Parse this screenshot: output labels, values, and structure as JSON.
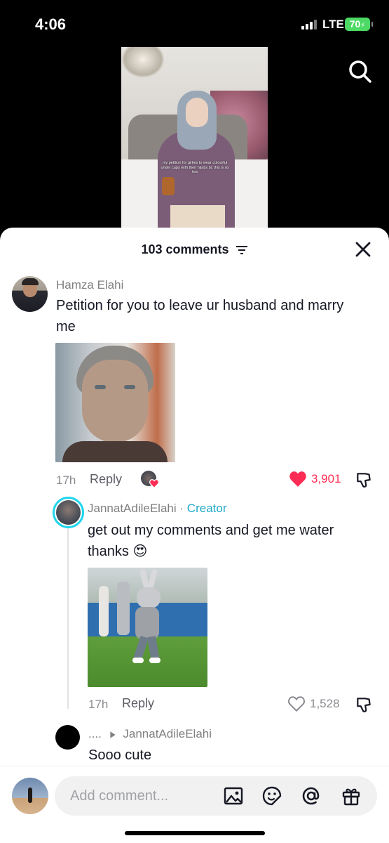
{
  "status_bar": {
    "time": "4:06",
    "network": "LTE",
    "battery": "70"
  },
  "video": {
    "caption": "my petition for girlies to wear colourful under caps with their hijabs bc this is so tea"
  },
  "sheet": {
    "title": "103 comments",
    "sort_icon": "sort-icon",
    "close_icon": "close-icon"
  },
  "comments": [
    {
      "username": "Hamza Elahi",
      "text": "Petition for you to leave ur husband and marry me",
      "time": "17h",
      "reply_label": "Reply",
      "likes": "3,901",
      "liked": true,
      "image": "homelander-photo"
    },
    {
      "username": "JannatAdileElahi",
      "badge": "Creator",
      "separator": "·",
      "text": "get out my comments and get me water thanks 😍",
      "time": "17h",
      "reply_label": "Reply",
      "likes": "1,528",
      "liked": false,
      "image": "dancing-bunny-photo"
    },
    {
      "username": "....",
      "reply_to": "JannatAdileElahi",
      "text": "Sooo cute"
    }
  ],
  "composer": {
    "placeholder": "Add comment...",
    "icons": [
      "image-icon",
      "sticker-icon",
      "mention-icon",
      "gift-icon"
    ]
  },
  "colors": {
    "like_red": "#fe2c55",
    "creator_teal": "#20a9c9",
    "text": "#161823",
    "muted": "#808080"
  }
}
